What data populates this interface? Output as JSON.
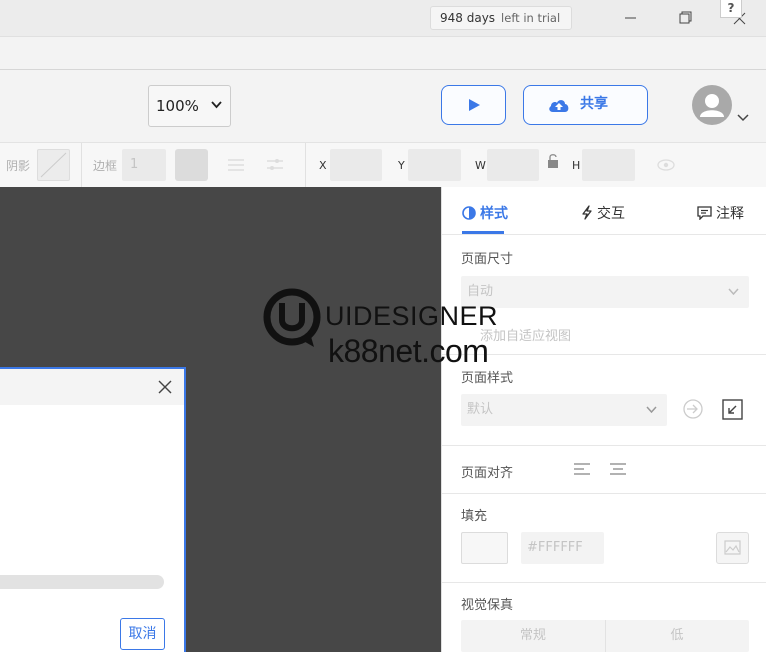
{
  "trial": {
    "days": "948 days",
    "suffix": "left in trial"
  },
  "help_mark": "?",
  "toolbar": {
    "zoom": "100%",
    "share_label": "共享"
  },
  "propbar": {
    "shadow_label": "阴影",
    "border_label": "边框",
    "border_value": "1",
    "x_label": "X",
    "y_label": "Y",
    "w_label": "W",
    "h_label": "H"
  },
  "dialog": {
    "cancel_label": "取消"
  },
  "watermark": {
    "line1": "UIDESIGNER",
    "line2": "k88net.com"
  },
  "panel": {
    "tabs": [
      {
        "label": "样式"
      },
      {
        "label": "交互"
      },
      {
        "label": "注释"
      }
    ],
    "page_size": {
      "title": "页面尺寸",
      "value": "自动",
      "adaptive_link": "添加自适应视图"
    },
    "page_style": {
      "title": "页面样式",
      "value": "默认"
    },
    "page_align": {
      "title": "页面对齐"
    },
    "fill": {
      "title": "填充",
      "hex": "#FFFFFF"
    },
    "fidelity": {
      "title": "视觉保真",
      "options": [
        "常规",
        "低"
      ]
    }
  },
  "colors": {
    "accent": "#3b78e7",
    "canvas": "#474747"
  }
}
